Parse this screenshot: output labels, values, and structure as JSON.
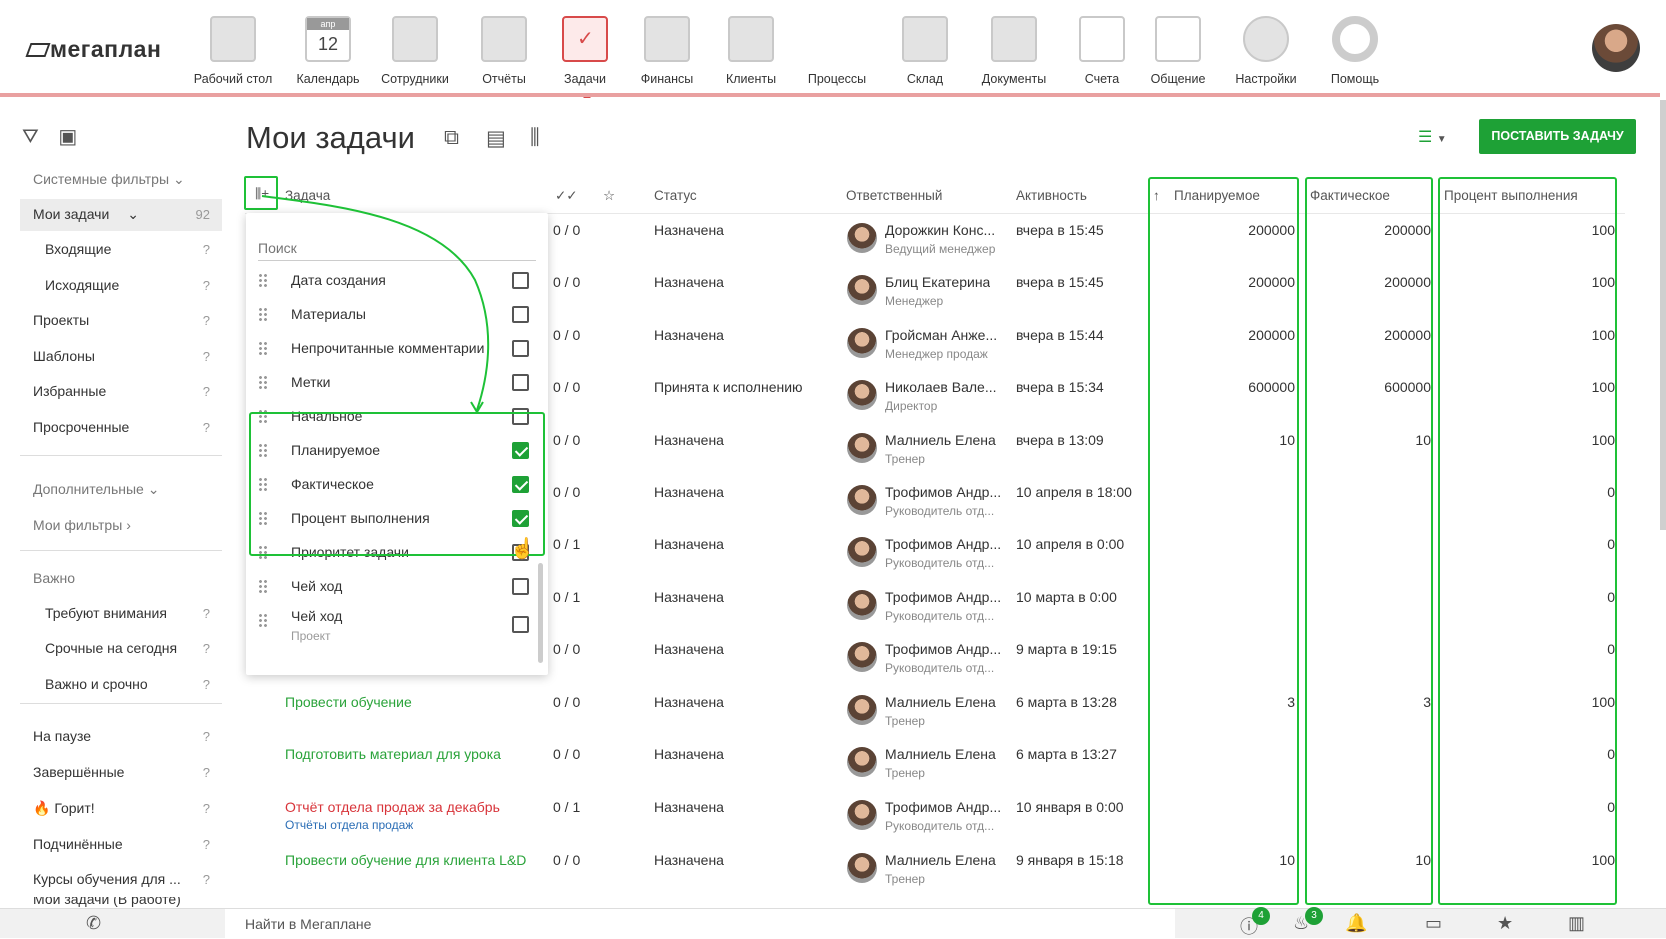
{
  "app": {
    "logo": "мегаплан"
  },
  "nav": [
    {
      "label": "Рабочий стол",
      "icon": "desktop-icon"
    },
    {
      "label": "Календарь",
      "icon": "calendar-icon",
      "cal_month": "апр",
      "cal_day": "12"
    },
    {
      "label": "Сотрудники",
      "icon": "employees-icon"
    },
    {
      "label": "Отчёты",
      "icon": "reports-icon"
    },
    {
      "label": "Задачи",
      "icon": "tasks-icon"
    },
    {
      "label": "Финансы",
      "icon": "finance-icon"
    },
    {
      "label": "Клиенты",
      "icon": "clients-icon"
    },
    {
      "label": "Процессы",
      "icon": "processes-icon"
    },
    {
      "label": "Склад",
      "icon": "warehouse-icon"
    },
    {
      "label": "Документы",
      "icon": "documents-icon"
    },
    {
      "label": "Счета",
      "icon": "invoices-icon"
    },
    {
      "label": "Общение",
      "icon": "chat-icon"
    },
    {
      "label": "Настройки",
      "icon": "settings-icon"
    },
    {
      "label": "Помощь",
      "icon": "help-icon"
    }
  ],
  "sidebar": {
    "items": [
      {
        "label": "Системные фильтры",
        "count": ""
      },
      {
        "label": "Мои задачи",
        "count": "92"
      },
      {
        "label": "Входящие",
        "count": "?"
      },
      {
        "label": "Исходящие",
        "count": "?"
      },
      {
        "label": "Проекты",
        "count": "?"
      },
      {
        "label": "Шаблоны",
        "count": "?"
      },
      {
        "label": "Избранные",
        "count": "?"
      },
      {
        "label": "Просроченные",
        "count": "?"
      },
      {
        "label": "Дополнительные",
        "count": ""
      },
      {
        "label": "Мои фильтры",
        "count": ""
      },
      {
        "label": "Важно",
        "count": ""
      },
      {
        "label": "Требуют внимания",
        "count": "?"
      },
      {
        "label": "Срочные на сегодня",
        "count": "?"
      },
      {
        "label": "Важно и срочно",
        "count": "?"
      },
      {
        "label": "На паузе",
        "count": "?"
      },
      {
        "label": "Завершённые",
        "count": "?"
      },
      {
        "label": "Горит!",
        "count": "?"
      },
      {
        "label": "Подчинённые",
        "count": "?"
      },
      {
        "label": "Курсы обучения для ...",
        "count": "?"
      },
      {
        "label": "Мои задачи (В работе)",
        "count": "?"
      }
    ]
  },
  "page": {
    "title": "Мои задачи",
    "add_button": "ПОСТАВИТЬ ЗАДАЧУ"
  },
  "table": {
    "headers": {
      "task": "Задача",
      "status": "Статус",
      "responsible": "Ответственный",
      "activity": "Активность",
      "planned": "Планируемое",
      "actual": "Фактическое",
      "percent": "Процент выполнения"
    },
    "rows": [
      {
        "task": "",
        "task_sub": "",
        "checks": "0 / 0",
        "status": "Назначена",
        "person": "Дорожкин Конс...",
        "role": "Ведущий менеджер",
        "activity": "вчера в 15:45",
        "planned": "200000",
        "actual": "200000",
        "percent": "100"
      },
      {
        "task": "",
        "task_sub": "",
        "checks": "0 / 0",
        "status": "Назначена",
        "person": "Блиц Екатерина",
        "role": "Менеджер",
        "activity": "вчера в 15:45",
        "planned": "200000",
        "actual": "200000",
        "percent": "100"
      },
      {
        "task": "",
        "task_sub": "",
        "checks": "0 / 0",
        "status": "Назначена",
        "person": "Гройсман Анже...",
        "role": "Менеджер продаж",
        "activity": "вчера в 15:44",
        "planned": "200000",
        "actual": "200000",
        "percent": "100"
      },
      {
        "task": "",
        "task_sub": "",
        "checks": "0 / 0",
        "status": "Принята к исполнению",
        "person": "Николаев Вале...",
        "role": "Директор",
        "activity": "вчера в 15:34",
        "planned": "600000",
        "actual": "600000",
        "percent": "100"
      },
      {
        "task": "",
        "task_sub": "",
        "checks": "0 / 0",
        "status": "Назначена",
        "person": "Малниель Елена",
        "role": "Тренер",
        "activity": "вчера в 13:09",
        "planned": "10",
        "actual": "10",
        "percent": "100"
      },
      {
        "task": "",
        "task_sub": "",
        "checks": "0 / 0",
        "status": "Назначена",
        "person": "Трофимов Андр...",
        "role": "Руководитель отд...",
        "activity": "10 апреля в 18:00",
        "planned": "",
        "actual": "",
        "percent": "0"
      },
      {
        "task": "",
        "task_sub": "",
        "checks": "0 / 1",
        "status": "Назначена",
        "person": "Трофимов Андр...",
        "role": "Руководитель отд...",
        "activity": "10 апреля в 0:00",
        "planned": "",
        "actual": "",
        "percent": "0"
      },
      {
        "task": "",
        "task_sub": "",
        "checks": "0 / 1",
        "status": "Назначена",
        "person": "Трофимов Андр...",
        "role": "Руководитель отд...",
        "activity": "10 марта в 0:00",
        "planned": "",
        "actual": "",
        "percent": "0"
      },
      {
        "task": "",
        "task_sub": "",
        "checks": "0 / 0",
        "status": "Назначена",
        "person": "Трофимов Андр...",
        "role": "Руководитель отд...",
        "activity": "9 марта в 19:15",
        "planned": "",
        "actual": "",
        "percent": "0"
      },
      {
        "task": "Провести обучение",
        "task_sub": "",
        "checks": "0 / 0",
        "status": "Назначена",
        "person": "Малниель Елена",
        "role": "Тренер",
        "activity": "6 марта в 13:28",
        "planned": "3",
        "actual": "3",
        "percent": "100"
      },
      {
        "task": "Подготовить материал для урока",
        "task_sub": "",
        "checks": "0 / 0",
        "status": "Назначена",
        "person": "Малниель Елена",
        "role": "Тренер",
        "activity": "6 марта в 13:27",
        "planned": "",
        "actual": "",
        "percent": "0"
      },
      {
        "task": "Отчёт отдела продаж за декабрь",
        "task_sub": "Отчёты отдела продаж",
        "checks": "0 / 1",
        "status": "Назначена",
        "person": "Трофимов Андр...",
        "role": "Руководитель отд...",
        "activity": "10 января в 0:00",
        "planned": "",
        "actual": "",
        "percent": "0"
      },
      {
        "task": "Провести обучение для клиента L&D",
        "task_sub": "",
        "checks": "0 / 0",
        "status": "Назначена",
        "person": "Малниель Елена",
        "role": "Тренер",
        "activity": "9 января в 15:18",
        "planned": "10",
        "actual": "10",
        "percent": "100"
      }
    ]
  },
  "dropdown": {
    "search_placeholder": "Поиск",
    "items": [
      {
        "label": "Дата создания",
        "sub": "",
        "checked": false
      },
      {
        "label": "Материалы",
        "sub": "",
        "checked": false
      },
      {
        "label": "Непрочитанные комментарии",
        "sub": "",
        "checked": false
      },
      {
        "label": "Метки",
        "sub": "",
        "checked": false
      },
      {
        "label": "Начальное",
        "sub": "",
        "checked": false
      },
      {
        "label": "Планируемое",
        "sub": "",
        "checked": true
      },
      {
        "label": "Фактическое",
        "sub": "",
        "checked": true
      },
      {
        "label": "Процент выполнения",
        "sub": "",
        "checked": true
      },
      {
        "label": "Приоритет задачи",
        "sub": "",
        "checked": false
      },
      {
        "label": "Чей ход",
        "sub": "",
        "checked": false
      },
      {
        "label": "Чей ход",
        "sub": "Проект",
        "checked": false
      }
    ]
  },
  "bottombar": {
    "search_text": "Найти в Мегаплане",
    "badge_alerts": "4",
    "badge_fire": "3"
  },
  "colors": {
    "accent": "#1ea136",
    "highlight": "#1ec137",
    "task_red": "#d8343a",
    "task_green": "#2aa33a"
  }
}
